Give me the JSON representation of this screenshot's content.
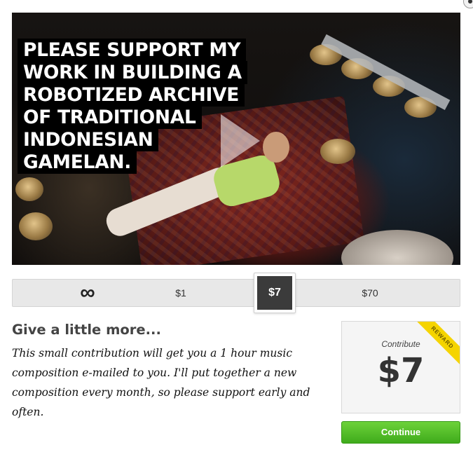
{
  "video": {
    "headline_lines": [
      "PLEASE SUPPORT MY",
      "WORK IN BUILDING A",
      "ROBOTIZED ARCHIVE",
      "OF TRADITIONAL",
      "INDONESIAN",
      "GAMELAN."
    ],
    "play_icon": "play-icon"
  },
  "amounts": {
    "options": [
      "$1",
      "$7",
      "$70"
    ],
    "selected": "$7",
    "infinity_icon": "infinity-icon"
  },
  "tier": {
    "title": "Give a little more...",
    "description": "This small contribution will get you a 1 hour music composition e-mailed to you. I'll put together a new composition every month, so please support early and often."
  },
  "reward": {
    "label": "Contribute",
    "amount": "$7",
    "ribbon": "REWARD"
  },
  "cta": {
    "continue_label": "Continue",
    "color": "#4cbf26"
  }
}
